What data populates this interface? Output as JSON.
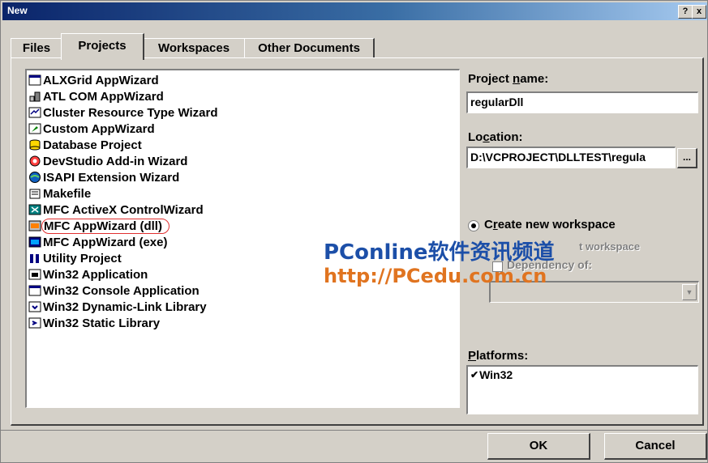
{
  "window": {
    "title": "New",
    "help_label": "?",
    "close_label": "x"
  },
  "tabs": [
    {
      "label": "Files",
      "active": false
    },
    {
      "label": "Projects",
      "active": true
    },
    {
      "label": "Workspaces",
      "active": false
    },
    {
      "label": "Other Documents",
      "active": false
    }
  ],
  "project_types": [
    {
      "label": "ALXGrid AppWizard",
      "icon": "blank-window-icon"
    },
    {
      "label": "ATL COM AppWizard",
      "icon": "atl-icon"
    },
    {
      "label": "Cluster Resource Type Wizard",
      "icon": "cluster-icon"
    },
    {
      "label": "Custom AppWizard",
      "icon": "custom-wizard-icon"
    },
    {
      "label": "Database Project",
      "icon": "database-icon"
    },
    {
      "label": "DevStudio Add-in Wizard",
      "icon": "addin-icon"
    },
    {
      "label": "ISAPI Extension Wizard",
      "icon": "globe-icon"
    },
    {
      "label": "Makefile",
      "icon": "makefile-icon"
    },
    {
      "label": "MFC ActiveX ControlWizard",
      "icon": "activex-icon"
    },
    {
      "label": "MFC AppWizard (dll)",
      "icon": "mfc-dll-icon",
      "highlighted": true
    },
    {
      "label": "MFC AppWizard (exe)",
      "icon": "mfc-exe-icon"
    },
    {
      "label": "Utility Project",
      "icon": "utility-icon"
    },
    {
      "label": "Win32 Application",
      "icon": "win32-app-icon"
    },
    {
      "label": "Win32 Console Application",
      "icon": "console-icon"
    },
    {
      "label": "Win32 Dynamic-Link Library",
      "icon": "dll-icon"
    },
    {
      "label": "Win32 Static Library",
      "icon": "lib-icon"
    }
  ],
  "project_name": {
    "label_pre": "Project ",
    "label_key": "n",
    "label_post": "ame:",
    "value": "regularDll"
  },
  "location": {
    "label_pre": "Lo",
    "label_key": "c",
    "label_post": "ation:",
    "value": "D:\\VCPROJECT\\DLLTEST\\regula",
    "browse_label": "..."
  },
  "workspace": {
    "create_pre": "C",
    "create_key": "r",
    "create_post": "eate new workspace",
    "add_label": "t workspace",
    "dependency_label": "Dependency of:"
  },
  "platforms": {
    "label_key": "P",
    "label_post": "latforms:",
    "items": [
      {
        "label": "Win32",
        "checked": true
      }
    ]
  },
  "buttons": {
    "ok": "OK",
    "cancel": "Cancel"
  },
  "watermark": {
    "line1": "PConline软件资讯频道",
    "line2": "http://PCedu.com.cn"
  },
  "colors": {
    "titlebar_start": "#0a246a",
    "face": "#d4d0c8",
    "highlight_ring": "#e03030",
    "watermark_blue": "#1c4fa8",
    "watermark_orange": "#e07420"
  }
}
